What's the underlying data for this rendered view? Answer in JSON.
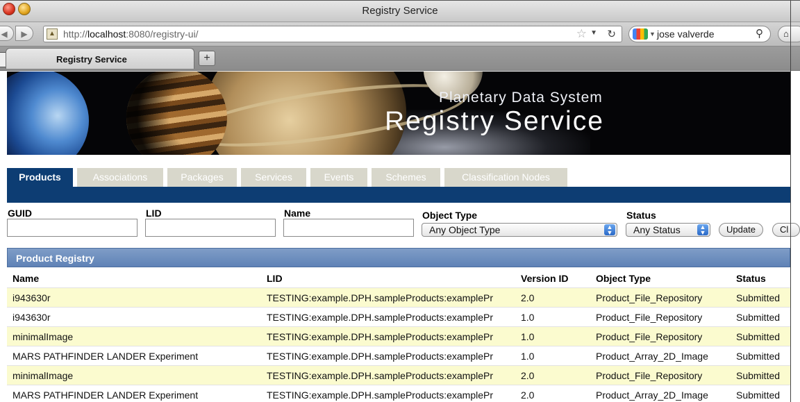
{
  "window": {
    "title": "Registry Service"
  },
  "browser": {
    "url_prefix": "http://",
    "url_host": "localhost",
    "url_rest": ":8080/registry-ui/",
    "search_value": "jose valverde",
    "tab_title": "Registry Service",
    "new_tab_label": "+"
  },
  "banner": {
    "subtitle": "Planetary Data System",
    "title": "Registry Service"
  },
  "app_tabs": [
    {
      "label": "Products",
      "active": true
    },
    {
      "label": "Associations",
      "active": false
    },
    {
      "label": "Packages",
      "active": false
    },
    {
      "label": "Services",
      "active": false
    },
    {
      "label": "Events",
      "active": false
    },
    {
      "label": "Schemes",
      "active": false
    },
    {
      "label": "Classification Nodes",
      "active": false
    }
  ],
  "filters": {
    "guid_label": "GUID",
    "lid_label": "LID",
    "name_label": "Name",
    "object_type_label": "Object Type",
    "object_type_value": "Any Object Type",
    "status_label": "Status",
    "status_value": "Any Status",
    "update_button": "Update",
    "clear_button": "Cl"
  },
  "registry": {
    "title": "Product Registry",
    "columns": [
      "Name",
      "LID",
      "Version ID",
      "Object Type",
      "Status"
    ],
    "rows": [
      {
        "name": "i943630r",
        "lid": "TESTING:example.DPH.sampleProducts:examplePr",
        "version": "2.0",
        "type": "Product_File_Repository",
        "status": "Submitted"
      },
      {
        "name": "i943630r",
        "lid": "TESTING:example.DPH.sampleProducts:examplePr",
        "version": "1.0",
        "type": "Product_File_Repository",
        "status": "Submitted"
      },
      {
        "name": "minimalImage",
        "lid": "TESTING:example.DPH.sampleProducts:examplePr",
        "version": "1.0",
        "type": "Product_File_Repository",
        "status": "Submitted"
      },
      {
        "name": "MARS PATHFINDER LANDER Experiment",
        "lid": "TESTING:example.DPH.sampleProducts:examplePr",
        "version": "1.0",
        "type": "Product_Array_2D_Image",
        "status": "Submitted"
      },
      {
        "name": "minimalImage",
        "lid": "TESTING:example.DPH.sampleProducts:examplePr",
        "version": "2.0",
        "type": "Product_File_Repository",
        "status": "Submitted"
      },
      {
        "name": "MARS PATHFINDER LANDER Experiment",
        "lid": "TESTING:example.DPH.sampleProducts:examplePr",
        "version": "2.0",
        "type": "Product_Array_2D_Image",
        "status": "Submitted"
      }
    ]
  },
  "colors": {
    "nav_blue": "#0d3d73",
    "inactive_tab": "#d8d7cb",
    "row_highlight": "#fbfbcf",
    "registry_header": "#6f8fbf"
  }
}
